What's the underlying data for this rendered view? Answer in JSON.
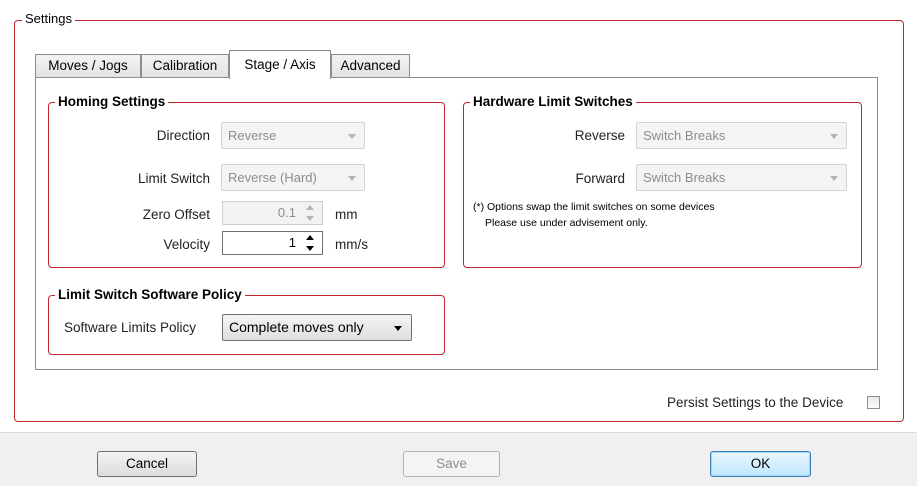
{
  "settings_group": {
    "title": "Settings"
  },
  "tabs": [
    {
      "label": "Moves / Jogs",
      "active": false
    },
    {
      "label": "Calibration",
      "active": false
    },
    {
      "label": "Stage / Axis",
      "active": true
    },
    {
      "label": "Advanced",
      "active": false
    }
  ],
  "homing": {
    "title": "Homing Settings",
    "direction_label": "Direction",
    "direction_value": "Reverse",
    "limit_switch_label": "Limit Switch",
    "limit_switch_value": "Reverse (Hard)",
    "zero_offset_label": "Zero Offset",
    "zero_offset_value": "0.1",
    "zero_offset_unit": "mm",
    "velocity_label": "Velocity",
    "velocity_value": "1",
    "velocity_unit": "mm/s"
  },
  "hardware_limits": {
    "title": "Hardware Limit Switches",
    "reverse_label": "Reverse",
    "reverse_value": "Switch Breaks",
    "forward_label": "Forward",
    "forward_value": "Switch Breaks",
    "note_line1": "(*) Options swap the limit switches on some devices",
    "note_line2": "Please use under advisement only."
  },
  "software_policy": {
    "title": "Limit Switch Software Policy",
    "label": "Software Limits Policy",
    "value": "Complete moves only"
  },
  "persist": {
    "label": "Persist Settings to the Device",
    "checked": false
  },
  "buttons": {
    "cancel": "Cancel",
    "save": "Save",
    "ok": "OK"
  },
  "colors": {
    "group_border": "#c0282e",
    "bottom_bar": "#f0f0f0"
  }
}
